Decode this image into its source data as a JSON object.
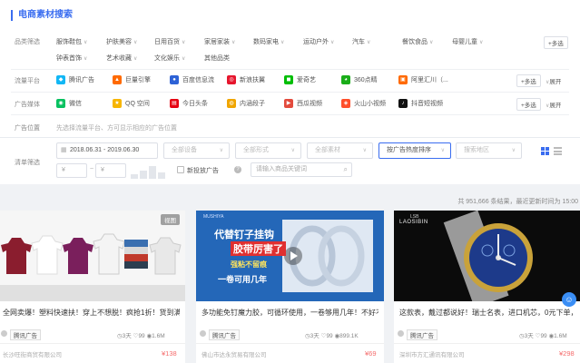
{
  "panel": {
    "title": "电商素材搜索",
    "labels": {
      "category": "品类筛选",
      "platform": "流量平台",
      "media": "广告媒体",
      "position": "广告位置",
      "clear": "清单筛选"
    },
    "categories_row1": [
      "服饰鞋包",
      "护肤美容",
      "日用百货",
      "家居家装",
      "数码家电",
      "运动户外",
      "汽车",
      "餐饮食品",
      "母婴儿童"
    ],
    "categories_row2": [
      "钟表首饰",
      "艺术收藏",
      "文化娱乐",
      "其他品类"
    ],
    "category_more": "+多选",
    "platforms": [
      "腾讯广告",
      "巨量引擎",
      "百度信息流",
      "新浪扶翼",
      "爱奇艺",
      "360点睛",
      "阿里汇川（..."
    ],
    "media": [
      "微信",
      "QQ 空间",
      "今日头条",
      "内涵段子",
      "西瓜视频",
      "火山小视频",
      "抖音短视频"
    ],
    "multi_label": "+多选",
    "expand_label": "展开",
    "position_hint": "先选择流量平台、方可显示相应的广告位置",
    "date_range": "2018.06.31  -  2019.06.30",
    "selects": [
      "全部设备",
      "全部形式",
      "全部素材",
      "按广告热度排序",
      "搜索地区"
    ],
    "price_min_placeholder": "¥",
    "price_max_placeholder": "¥",
    "new_ad_label": "新投放广告",
    "search_placeholder": "请输入商品关键词",
    "count_text": "共 951,666 条结果，最近更新时间为 15:00"
  },
  "cards": [
    {
      "title": "全网卖爆！塑料快速扶！穿上不想脱！疯抢1折！货到满意...",
      "tag": "腾讯广告",
      "days": "3天",
      "likes": "99",
      "views": "1.6M",
      "company": "长沙旺街商贸有限公司",
      "price": "¥138",
      "badge": "视图"
    },
    {
      "title": "多功能免钉魔力胶，可循环使用，一卷够用几年！不好不...",
      "tag": "腾讯广告",
      "days": "3天",
      "likes": "99",
      "views": "899.1K",
      "company": "佛山市达永贸易有限公司",
      "price": "¥69",
      "img_line1": "代替钉子挂钩",
      "img_line2": "胶带厉害了",
      "img_line3": "强粘不留痕",
      "img_line4": "一卷可用几年",
      "img_brand": "MUSHIYA"
    },
    {
      "title": "这款表，戴过都说好！瑞士名表，进口机芯，0元下单，满...",
      "tag": "腾讯广告",
      "days": "3天",
      "likes": "99",
      "views": "1.6M",
      "company": "深圳市方汇通讯有限公司",
      "price": "¥298",
      "img_brand": "LAOSIBIN",
      "img_brand_top": "LSB"
    }
  ]
}
